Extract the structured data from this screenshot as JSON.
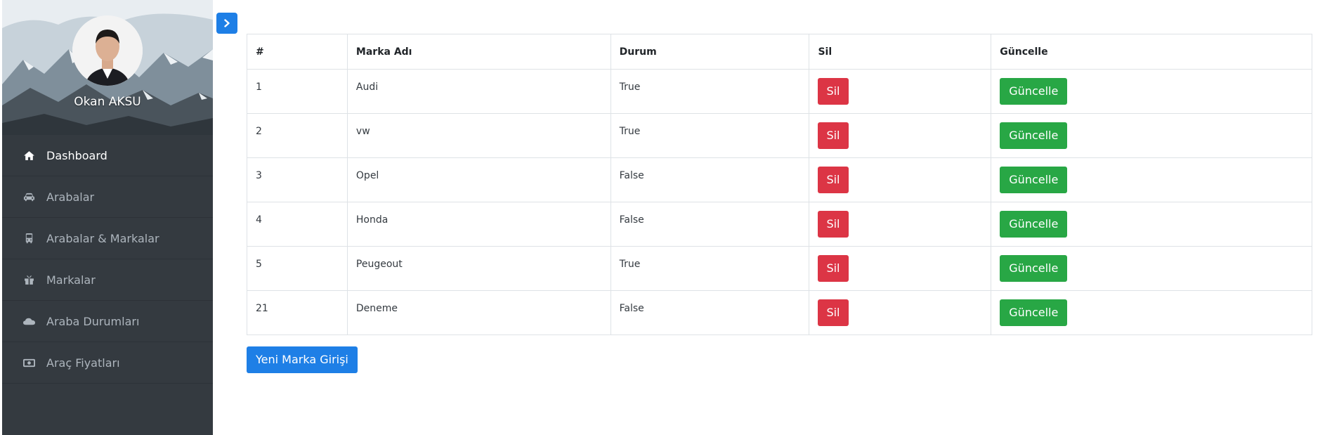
{
  "sidebar": {
    "profile_name": "Okan AKSU",
    "items": [
      {
        "label": "Dashboard",
        "icon": "home-icon",
        "active": true
      },
      {
        "label": "Arabalar",
        "icon": "car-icon",
        "active": false
      },
      {
        "label": "Arabalar & Markalar",
        "icon": "bus-icon",
        "active": false
      },
      {
        "label": "Markalar",
        "icon": "gift-icon",
        "active": false
      },
      {
        "label": "Araba Durumları",
        "icon": "cloud-icon",
        "active": false
      },
      {
        "label": "Araç Fiyatları",
        "icon": "money-icon",
        "active": false
      }
    ]
  },
  "toggle": {
    "icon": "chevron-right-icon"
  },
  "table": {
    "headers": [
      "#",
      "Marka Adı",
      "Durum",
      "Sil",
      "Güncelle"
    ],
    "rows": [
      {
        "id": "1",
        "name": "Audi",
        "status": "True",
        "delete_label": "Sil",
        "update_label": "Güncelle"
      },
      {
        "id": "2",
        "name": "vw",
        "status": "True",
        "delete_label": "Sil",
        "update_label": "Güncelle"
      },
      {
        "id": "3",
        "name": "Opel",
        "status": "False",
        "delete_label": "Sil",
        "update_label": "Güncelle"
      },
      {
        "id": "4",
        "name": "Honda",
        "status": "False",
        "delete_label": "Sil",
        "update_label": "Güncelle"
      },
      {
        "id": "5",
        "name": "Peugeout",
        "status": "True",
        "delete_label": "Sil",
        "update_label": "Güncelle"
      },
      {
        "id": "21",
        "name": "Deneme",
        "status": "False",
        "delete_label": "Sil",
        "update_label": "Güncelle"
      }
    ]
  },
  "new_brand_button": "Yeni Marka Girişi",
  "colors": {
    "sidebar_bg": "#343a40",
    "primary": "#1e7fe6",
    "danger": "#dc3545",
    "success": "#28a745"
  }
}
